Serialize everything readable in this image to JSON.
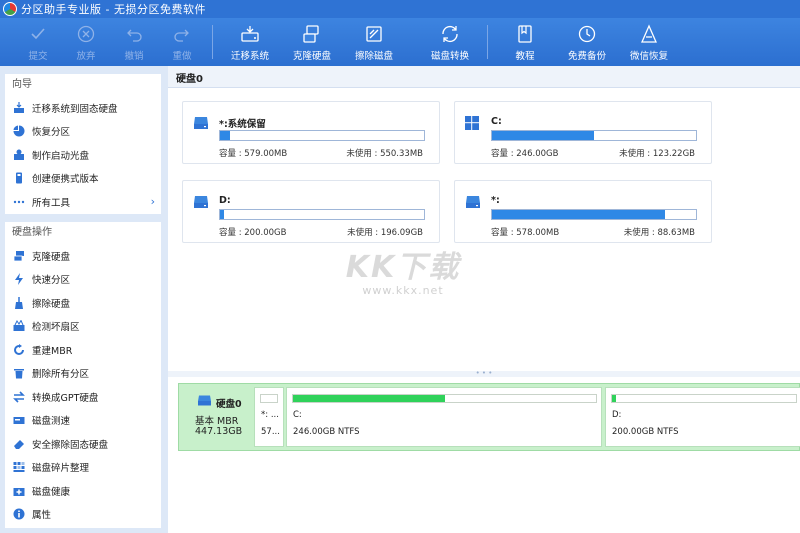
{
  "window": {
    "title": "分区助手专业版 - 无损分区免费软件"
  },
  "toolbar": {
    "buttons": [
      {
        "label": "提交",
        "icon": "check-icon",
        "enabled": false
      },
      {
        "label": "放弃",
        "icon": "discard-icon",
        "enabled": false
      },
      {
        "label": "撤销",
        "icon": "undo-icon",
        "enabled": false
      },
      {
        "label": "重做",
        "icon": "redo-icon",
        "enabled": false
      },
      {
        "label": "迁移系统",
        "icon": "migrate-os-icon",
        "enabled": true
      },
      {
        "label": "克隆硬盘",
        "icon": "clone-disk-icon",
        "enabled": true
      },
      {
        "label": "擦除磁盘",
        "icon": "wipe-disk-icon",
        "enabled": true
      },
      {
        "label": "磁盘转换",
        "icon": "convert-disk-icon",
        "enabled": true
      },
      {
        "label": "教程",
        "icon": "tutorial-icon",
        "enabled": true
      },
      {
        "label": "免费备份",
        "icon": "backup-icon",
        "enabled": true
      },
      {
        "label": "微信恢复",
        "icon": "recovery-icon",
        "enabled": true
      }
    ]
  },
  "sidebar": {
    "wizard": {
      "header": "向导",
      "items": [
        {
          "label": "迁移系统到固态硬盘",
          "icon": "migrate-ssd-icon"
        },
        {
          "label": "恢复分区",
          "icon": "pie-icon"
        },
        {
          "label": "制作启动光盘",
          "icon": "boot-disc-icon"
        },
        {
          "label": "创建便携式版本",
          "icon": "portable-icon"
        },
        {
          "label": "所有工具",
          "icon": "more-icon",
          "chevron": "›"
        }
      ]
    },
    "disk_ops": {
      "header": "硬盘操作",
      "items": [
        {
          "label": "克隆硬盘",
          "icon": "clone-icon"
        },
        {
          "label": "快速分区",
          "icon": "lightning-icon"
        },
        {
          "label": "擦除硬盘",
          "icon": "broom-icon"
        },
        {
          "label": "检测坏扇区",
          "icon": "scan-icon"
        },
        {
          "label": "重建MBR",
          "icon": "rebuild-icon"
        },
        {
          "label": "删除所有分区",
          "icon": "trash-icon"
        },
        {
          "label": "转换成GPT硬盘",
          "icon": "convert-icon"
        },
        {
          "label": "磁盘测速",
          "icon": "speed-icon"
        },
        {
          "label": "安全擦除固态硬盘",
          "icon": "eraser-icon"
        },
        {
          "label": "磁盘碎片整理",
          "icon": "defrag-icon"
        },
        {
          "label": "磁盘健康",
          "icon": "health-icon"
        },
        {
          "label": "属性",
          "icon": "info-icon"
        }
      ]
    }
  },
  "main": {
    "tab_label": "硬盘0",
    "partitions": [
      {
        "name": "*:系统保留",
        "icon": "drive-icon",
        "usage": 0.05,
        "capacity": "容量 : 579.00MB",
        "free": "未使用 : 550.33MB"
      },
      {
        "name": "C:",
        "icon": "windows-icon",
        "usage": 0.5,
        "capacity": "容量 : 246.00GB",
        "free": "未使用 : 123.22GB"
      },
      {
        "name": "D:",
        "icon": "drive-icon",
        "usage": 0.02,
        "capacity": "容量 : 200.00GB",
        "free": "未使用 : 196.09GB"
      },
      {
        "name": "*:",
        "icon": "drive-icon",
        "usage": 0.85,
        "capacity": "容量 : 578.00MB",
        "free": "未使用 : 88.63MB"
      }
    ],
    "watermark": {
      "logo": "KK下载",
      "url": "www.kkx.net"
    },
    "disk_map": {
      "name": "硬盘0",
      "type": "基本 MBR",
      "size": "447.13GB",
      "segments": [
        {
          "name": "*: ...",
          "info": "57...",
          "usage": 0.0
        },
        {
          "name": "C:",
          "info": "246.00GB NTFS",
          "usage": 0.5
        },
        {
          "name": "D:",
          "info": "200.00GB NTFS",
          "usage": 0.02
        }
      ]
    }
  },
  "colors": {
    "titlebar": "#2f73d4",
    "accent": "#2f88e6",
    "disk_row": "#c8f0cb",
    "partition_fill": "#2fd25a"
  }
}
